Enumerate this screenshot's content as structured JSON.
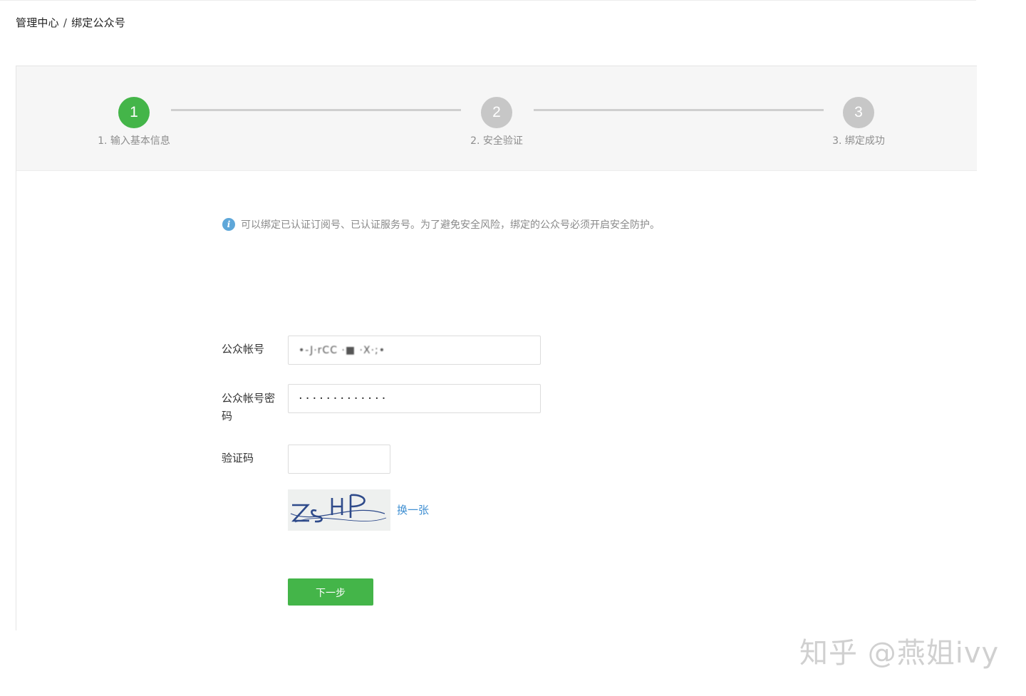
{
  "breadcrumb": {
    "parent": "管理中心",
    "separator": "/",
    "current": "绑定公众号"
  },
  "steps": [
    {
      "number": "1",
      "label": "1. 输入基本信息",
      "status": "active"
    },
    {
      "number": "2",
      "label": "2. 安全验证",
      "status": "pending"
    },
    {
      "number": "3",
      "label": "3. 绑定成功",
      "status": "pending"
    }
  ],
  "colors": {
    "accent": "#44b549",
    "pending": "#c7c7c7",
    "link": "#3f8fd2",
    "info": "#5ea7d9"
  },
  "notice": {
    "icon": "info-icon",
    "text": "可以绑定已认证订阅号、已认证服务号。为了避免安全风险，绑定的公众号必须开启安全防护。"
  },
  "form": {
    "account": {
      "label": "公众帐号",
      "value": "•-J·rCC ·■ ·X·;•"
    },
    "password": {
      "label_line1": "公众帐号密",
      "label_line2": "码",
      "value": "·············"
    },
    "captcha": {
      "label": "验证码",
      "value": "",
      "image_text": "ZsHP",
      "refresh_label": "换一张"
    },
    "next_label": "下一步"
  },
  "watermark": "知乎 @燕姐ivy"
}
